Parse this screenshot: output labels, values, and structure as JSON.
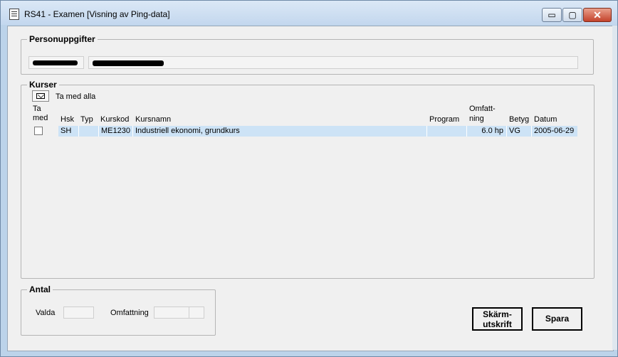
{
  "window": {
    "title": "RS41 - Examen [Visning av Ping-data]",
    "controls": {
      "minimize": "▭",
      "maximize": "▢",
      "close": "✕"
    }
  },
  "person": {
    "group_title": "Personuppgifter"
  },
  "courses": {
    "group_title": "Kurser",
    "select_all_label": "Ta med alla",
    "headers": {
      "take": "Ta\nmed",
      "hsk": "Hsk",
      "typ": "Typ",
      "kurskod": "Kurskod",
      "kursnamn": "Kursnamn",
      "program": "Program",
      "omfattning": "Omfatt-\nning",
      "betyg": "Betyg",
      "datum": "Datum"
    },
    "rows": [
      {
        "checked": false,
        "hsk": "SH",
        "typ": "",
        "kurskod": "ME1230",
        "kursnamn": "Industriell ekonomi, grundkurs",
        "program": "",
        "omfattning": "6.0 hp",
        "betyg": "VG",
        "datum": "2005-06-29"
      }
    ]
  },
  "antal": {
    "group_title": "Antal",
    "valda_label": "Valda",
    "valda_value": "",
    "omfattning_label": "Omfattning",
    "omfattning_value": ""
  },
  "buttons": {
    "print": "Skärm-\nutskrift",
    "save": "Spara"
  }
}
